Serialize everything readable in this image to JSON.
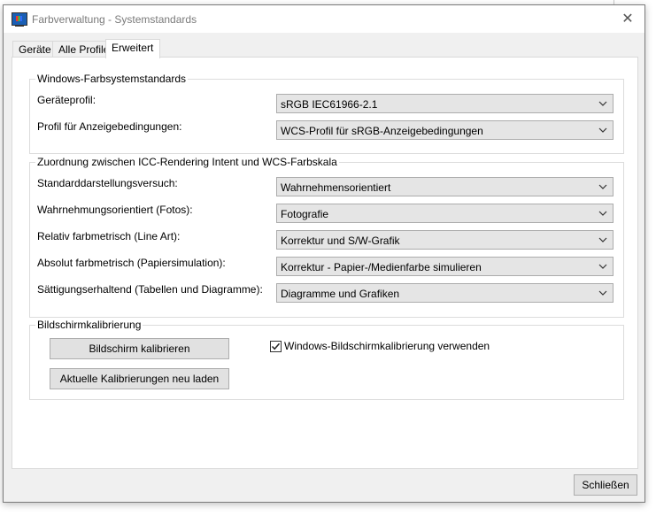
{
  "window": {
    "title": "Farbverwaltung - Systemstandards",
    "close_glyph": "✕"
  },
  "tabs": [
    {
      "label": "Geräte",
      "active": false
    },
    {
      "label": "Alle Profile",
      "active": false
    },
    {
      "label": "Erweitert",
      "active": true
    }
  ],
  "group_defaults": {
    "title": "Windows-Farbsystemstandards",
    "rows": [
      {
        "label": "Geräteprofil:",
        "value": "sRGB IEC61966-2.1"
      },
      {
        "label": "Profil für Anzeigebedingungen:",
        "value": "WCS-Profil für sRGB-Anzeigebedingungen"
      }
    ]
  },
  "group_mapping": {
    "title": "Zuordnung zwischen ICC-Rendering Intent und WCS-Farbskala",
    "rows": [
      {
        "label": "Standarddarstellungsversuch:",
        "value": "Wahrnehmensorientiert"
      },
      {
        "label": "Wahrnehmungsorientiert (Fotos):",
        "value": "Fotografie"
      },
      {
        "label": "Relativ farbmetrisch (Line Art):",
        "value": "Korrektur und S/W-Grafik"
      },
      {
        "label": "Absolut farbmetrisch (Papiersimulation):",
        "value": "Korrektur - Papier-/Medienfarbe simulieren"
      },
      {
        "label": "Sättigungserhaltend (Tabellen und Diagramme):",
        "value": "Diagramme und Grafiken"
      }
    ]
  },
  "group_calibration": {
    "title": "Bildschirmkalibrierung",
    "calibrate_button": "Bildschirm kalibrieren",
    "reload_button": "Aktuelle Kalibrierungen neu laden",
    "checkbox_label": "Windows-Bildschirmkalibrierung verwenden",
    "checkbox_checked": true
  },
  "footer": {
    "close_button": "Schließen"
  },
  "icons": {
    "app": "monitor-color-icon",
    "dropdown": "chevron-down-icon",
    "check": "checkmark-icon"
  },
  "colors": {
    "window_bg": "#f0f0f0",
    "panel_bg": "#ffffff",
    "combo_bg": "#e5e5e5",
    "button_bg": "#e1e1e1"
  }
}
